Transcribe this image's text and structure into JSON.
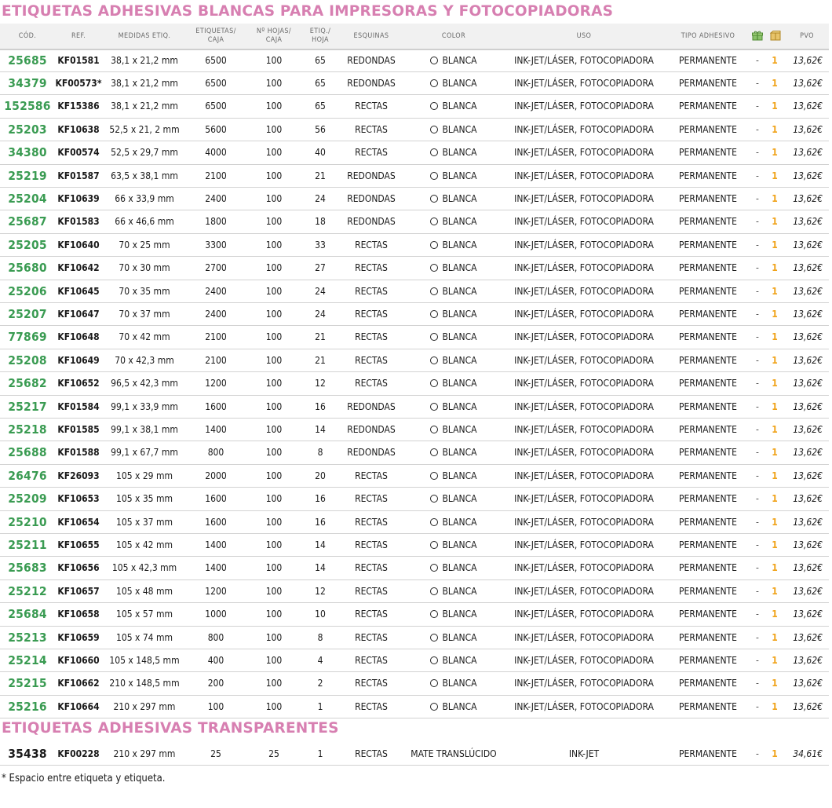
{
  "sections": {
    "main_title": "ETIQUETAS ADHESIVAS BLANCAS PARA IMPRESORAS Y FOTOCOPIADORAS",
    "transparent_title": "ETIQUETAS ADHESIVAS TRANSPARENTES"
  },
  "icons": {
    "header_icon_1": "gift-pack-icon",
    "header_icon_2": "box-icon"
  },
  "colors": {
    "section_title": "#d77fb1",
    "code": "#3a9b52",
    "qty": "#f0a31a"
  },
  "headers": {
    "cod": "CÓD.",
    "ref": "REF.",
    "medidas": "MEDIDAS ETIQ.",
    "etq_caja": "ETIQUETAS/\nCAJA",
    "hojas_caja": "Nº HOJAS/\nCAJA",
    "etq_hoja": "ETIQ./\nHOJA",
    "esquinas": "ESQUINAS",
    "color": "COLOR",
    "uso": "USO",
    "tipo": "TIPO ADHESIVO",
    "pvo": "PVO"
  },
  "rows": [
    {
      "cod": "25685",
      "ref": "KF01581",
      "medidas": "38,1 x 21,2 mm",
      "etq_caja": "6500",
      "hojas_caja": "100",
      "etq_hoja": "65",
      "esquinas": "REDONDAS",
      "color": "BLANCA",
      "uso": "INK-JET/LÁSER, FOTOCOPIADORA",
      "tipo": "PERMANENTE",
      "dash": "-",
      "qty": "1",
      "pvo": "13,62€"
    },
    {
      "cod": "34379",
      "ref": "KF00573*",
      "medidas": "38,1 x 21,2 mm",
      "etq_caja": "6500",
      "hojas_caja": "100",
      "etq_hoja": "65",
      "esquinas": "REDONDAS",
      "color": "BLANCA",
      "uso": "INK-JET/LÁSER, FOTOCOPIADORA",
      "tipo": "PERMANENTE",
      "dash": "-",
      "qty": "1",
      "pvo": "13,62€"
    },
    {
      "cod": "152586",
      "ref": "KF15386",
      "medidas": "38,1 x 21,2 mm",
      "etq_caja": "6500",
      "hojas_caja": "100",
      "etq_hoja": "65",
      "esquinas": "RECTAS",
      "color": "BLANCA",
      "uso": "INK-JET/LÁSER, FOTOCOPIADORA",
      "tipo": "PERMANENTE",
      "dash": "-",
      "qty": "1",
      "pvo": "13,62€"
    },
    {
      "cod": "25203",
      "ref": "KF10638",
      "medidas": "52,5 x 21, 2 mm",
      "etq_caja": "5600",
      "hojas_caja": "100",
      "etq_hoja": "56",
      "esquinas": "RECTAS",
      "color": "BLANCA",
      "uso": "INK-JET/LÁSER, FOTOCOPIADORA",
      "tipo": "PERMANENTE",
      "dash": "-",
      "qty": "1",
      "pvo": "13,62€"
    },
    {
      "cod": "34380",
      "ref": "KF00574",
      "medidas": "52,5 x 29,7 mm",
      "etq_caja": "4000",
      "hojas_caja": "100",
      "etq_hoja": "40",
      "esquinas": "RECTAS",
      "color": "BLANCA",
      "uso": "INK-JET/LÁSER, FOTOCOPIADORA",
      "tipo": "PERMANENTE",
      "dash": "-",
      "qty": "1",
      "pvo": "13,62€"
    },
    {
      "cod": "25219",
      "ref": "KF01587",
      "medidas": "63,5 x 38,1 mm",
      "etq_caja": "2100",
      "hojas_caja": "100",
      "etq_hoja": "21",
      "esquinas": "REDONDAS",
      "color": "BLANCA",
      "uso": "INK-JET/LÁSER, FOTOCOPIADORA",
      "tipo": "PERMANENTE",
      "dash": "-",
      "qty": "1",
      "pvo": "13,62€"
    },
    {
      "cod": "25204",
      "ref": "KF10639",
      "medidas": "66 x 33,9 mm",
      "etq_caja": "2400",
      "hojas_caja": "100",
      "etq_hoja": "24",
      "esquinas": "REDONDAS",
      "color": "BLANCA",
      "uso": "INK-JET/LÁSER, FOTOCOPIADORA",
      "tipo": "PERMANENTE",
      "dash": "-",
      "qty": "1",
      "pvo": "13,62€"
    },
    {
      "cod": "25687",
      "ref": "KF01583",
      "medidas": "66 x 46,6 mm",
      "etq_caja": "1800",
      "hojas_caja": "100",
      "etq_hoja": "18",
      "esquinas": "REDONDAS",
      "color": "BLANCA",
      "uso": "INK-JET/LÁSER, FOTOCOPIADORA",
      "tipo": "PERMANENTE",
      "dash": "-",
      "qty": "1",
      "pvo": "13,62€"
    },
    {
      "cod": "25205",
      "ref": "KF10640",
      "medidas": "70 x 25 mm",
      "etq_caja": "3300",
      "hojas_caja": "100",
      "etq_hoja": "33",
      "esquinas": "RECTAS",
      "color": "BLANCA",
      "uso": "INK-JET/LÁSER, FOTOCOPIADORA",
      "tipo": "PERMANENTE",
      "dash": "-",
      "qty": "1",
      "pvo": "13,62€"
    },
    {
      "cod": "25680",
      "ref": "KF10642",
      "medidas": "70 x 30 mm",
      "etq_caja": "2700",
      "hojas_caja": "100",
      "etq_hoja": "27",
      "esquinas": "RECTAS",
      "color": "BLANCA",
      "uso": "INK-JET/LÁSER, FOTOCOPIADORA",
      "tipo": "PERMANENTE",
      "dash": "-",
      "qty": "1",
      "pvo": "13,62€"
    },
    {
      "cod": "25206",
      "ref": "KF10645",
      "medidas": "70 x 35 mm",
      "etq_caja": "2400",
      "hojas_caja": "100",
      "etq_hoja": "24",
      "esquinas": "RECTAS",
      "color": "BLANCA",
      "uso": "INK-JET/LÁSER, FOTOCOPIADORA",
      "tipo": "PERMANENTE",
      "dash": "-",
      "qty": "1",
      "pvo": "13,62€"
    },
    {
      "cod": "25207",
      "ref": "KF10647",
      "medidas": "70 x 37 mm",
      "etq_caja": "2400",
      "hojas_caja": "100",
      "etq_hoja": "24",
      "esquinas": "RECTAS",
      "color": "BLANCA",
      "uso": "INK-JET/LÁSER, FOTOCOPIADORA",
      "tipo": "PERMANENTE",
      "dash": "-",
      "qty": "1",
      "pvo": "13,62€"
    },
    {
      "cod": "77869",
      "ref": "KF10648",
      "medidas": "70 x 42 mm",
      "etq_caja": "2100",
      "hojas_caja": "100",
      "etq_hoja": "21",
      "esquinas": "RECTAS",
      "color": "BLANCA",
      "uso": "INK-JET/LÁSER, FOTOCOPIADORA",
      "tipo": "PERMANENTE",
      "dash": "-",
      "qty": "1",
      "pvo": "13,62€"
    },
    {
      "cod": "25208",
      "ref": "KF10649",
      "medidas": "70 x 42,3 mm",
      "etq_caja": "2100",
      "hojas_caja": "100",
      "etq_hoja": "21",
      "esquinas": "RECTAS",
      "color": "BLANCA",
      "uso": "INK-JET/LÁSER, FOTOCOPIADORA",
      "tipo": "PERMANENTE",
      "dash": "-",
      "qty": "1",
      "pvo": "13,62€"
    },
    {
      "cod": "25682",
      "ref": "KF10652",
      "medidas": "96,5 x 42,3 mm",
      "etq_caja": "1200",
      "hojas_caja": "100",
      "etq_hoja": "12",
      "esquinas": "RECTAS",
      "color": "BLANCA",
      "uso": "INK-JET/LÁSER, FOTOCOPIADORA",
      "tipo": "PERMANENTE",
      "dash": "-",
      "qty": "1",
      "pvo": "13,62€"
    },
    {
      "cod": "25217",
      "ref": "KF01584",
      "medidas": "99,1 x 33,9 mm",
      "etq_caja": "1600",
      "hojas_caja": "100",
      "etq_hoja": "16",
      "esquinas": "REDONDAS",
      "color": "BLANCA",
      "uso": "INK-JET/LÁSER, FOTOCOPIADORA",
      "tipo": "PERMANENTE",
      "dash": "-",
      "qty": "1",
      "pvo": "13,62€"
    },
    {
      "cod": "25218",
      "ref": "KF01585",
      "medidas": "99,1 x 38,1 mm",
      "etq_caja": "1400",
      "hojas_caja": "100",
      "etq_hoja": "14",
      "esquinas": "REDONDAS",
      "color": "BLANCA",
      "uso": "INK-JET/LÁSER, FOTOCOPIADORA",
      "tipo": "PERMANENTE",
      "dash": "-",
      "qty": "1",
      "pvo": "13,62€"
    },
    {
      "cod": "25688",
      "ref": "KF01588",
      "medidas": "99,1 x 67,7 mm",
      "etq_caja": "800",
      "hojas_caja": "100",
      "etq_hoja": "8",
      "esquinas": "REDONDAS",
      "color": "BLANCA",
      "uso": "INK-JET/LÁSER, FOTOCOPIADORA",
      "tipo": "PERMANENTE",
      "dash": "-",
      "qty": "1",
      "pvo": "13,62€"
    },
    {
      "cod": "26476",
      "ref": "KF26093",
      "medidas": "105 x 29 mm",
      "etq_caja": "2000",
      "hojas_caja": "100",
      "etq_hoja": "20",
      "esquinas": "RECTAS",
      "color": "BLANCA",
      "uso": "INK-JET/LÁSER, FOTOCOPIADORA",
      "tipo": "PERMANENTE",
      "dash": "-",
      "qty": "1",
      "pvo": "13,62€"
    },
    {
      "cod": "25209",
      "ref": "KF10653",
      "medidas": "105 x 35 mm",
      "etq_caja": "1600",
      "hojas_caja": "100",
      "etq_hoja": "16",
      "esquinas": "RECTAS",
      "color": "BLANCA",
      "uso": "INK-JET/LÁSER, FOTOCOPIADORA",
      "tipo": "PERMANENTE",
      "dash": "-",
      "qty": "1",
      "pvo": "13,62€"
    },
    {
      "cod": "25210",
      "ref": "KF10654",
      "medidas": "105 x 37 mm",
      "etq_caja": "1600",
      "hojas_caja": "100",
      "etq_hoja": "16",
      "esquinas": "RECTAS",
      "color": "BLANCA",
      "uso": "INK-JET/LÁSER, FOTOCOPIADORA",
      "tipo": "PERMANENTE",
      "dash": "-",
      "qty": "1",
      "pvo": "13,62€"
    },
    {
      "cod": "25211",
      "ref": "KF10655",
      "medidas": "105 x 42 mm",
      "etq_caja": "1400",
      "hojas_caja": "100",
      "etq_hoja": "14",
      "esquinas": "RECTAS",
      "color": "BLANCA",
      "uso": "INK-JET/LÁSER, FOTOCOPIADORA",
      "tipo": "PERMANENTE",
      "dash": "-",
      "qty": "1",
      "pvo": "13,62€"
    },
    {
      "cod": "25683",
      "ref": "KF10656",
      "medidas": "105 x 42,3 mm",
      "etq_caja": "1400",
      "hojas_caja": "100",
      "etq_hoja": "14",
      "esquinas": "RECTAS",
      "color": "BLANCA",
      "uso": "INK-JET/LÁSER, FOTOCOPIADORA",
      "tipo": "PERMANENTE",
      "dash": "-",
      "qty": "1",
      "pvo": "13,62€"
    },
    {
      "cod": "25212",
      "ref": "KF10657",
      "medidas": "105 x 48 mm",
      "etq_caja": "1200",
      "hojas_caja": "100",
      "etq_hoja": "12",
      "esquinas": "RECTAS",
      "color": "BLANCA",
      "uso": "INK-JET/LÁSER, FOTOCOPIADORA",
      "tipo": "PERMANENTE",
      "dash": "-",
      "qty": "1",
      "pvo": "13,62€"
    },
    {
      "cod": "25684",
      "ref": "KF10658",
      "medidas": "105 x 57 mm",
      "etq_caja": "1000",
      "hojas_caja": "100",
      "etq_hoja": "10",
      "esquinas": "RECTAS",
      "color": "BLANCA",
      "uso": "INK-JET/LÁSER, FOTOCOPIADORA",
      "tipo": "PERMANENTE",
      "dash": "-",
      "qty": "1",
      "pvo": "13,62€"
    },
    {
      "cod": "25213",
      "ref": "KF10659",
      "medidas": "105 x 74 mm",
      "etq_caja": "800",
      "hojas_caja": "100",
      "etq_hoja": "8",
      "esquinas": "RECTAS",
      "color": "BLANCA",
      "uso": "INK-JET/LÁSER, FOTOCOPIADORA",
      "tipo": "PERMANENTE",
      "dash": "-",
      "qty": "1",
      "pvo": "13,62€"
    },
    {
      "cod": "25214",
      "ref": "KF10660",
      "medidas": "105 x 148,5 mm",
      "etq_caja": "400",
      "hojas_caja": "100",
      "etq_hoja": "4",
      "esquinas": "RECTAS",
      "color": "BLANCA",
      "uso": "INK-JET/LÁSER, FOTOCOPIADORA",
      "tipo": "PERMANENTE",
      "dash": "-",
      "qty": "1",
      "pvo": "13,62€"
    },
    {
      "cod": "25215",
      "ref": "KF10662",
      "medidas": "210 x 148,5 mm",
      "etq_caja": "200",
      "hojas_caja": "100",
      "etq_hoja": "2",
      "esquinas": "RECTAS",
      "color": "BLANCA",
      "uso": "INK-JET/LÁSER, FOTOCOPIADORA",
      "tipo": "PERMANENTE",
      "dash": "-",
      "qty": "1",
      "pvo": "13,62€"
    },
    {
      "cod": "25216",
      "ref": "KF10664",
      "medidas": "210 x 297 mm",
      "etq_caja": "100",
      "hojas_caja": "100",
      "etq_hoja": "1",
      "esquinas": "RECTAS",
      "color": "BLANCA",
      "uso": "INK-JET/LÁSER, FOTOCOPIADORA",
      "tipo": "PERMANENTE",
      "dash": "-",
      "qty": "1",
      "pvo": "13,62€"
    }
  ],
  "transparent_rows": [
    {
      "cod": "35438",
      "ref": "KF00228",
      "medidas": "210 x 297 mm",
      "etq_caja": "25",
      "hojas_caja": "25",
      "etq_hoja": "1",
      "esquinas": "RECTAS",
      "color": "MATE  TRANSLÚCIDO",
      "uso": "INK-JET",
      "tipo": "PERMANENTE",
      "dash": "-",
      "qty": "1",
      "pvo": "34,61€"
    }
  ],
  "footnote": "* Espacio entre etiqueta y etiqueta."
}
